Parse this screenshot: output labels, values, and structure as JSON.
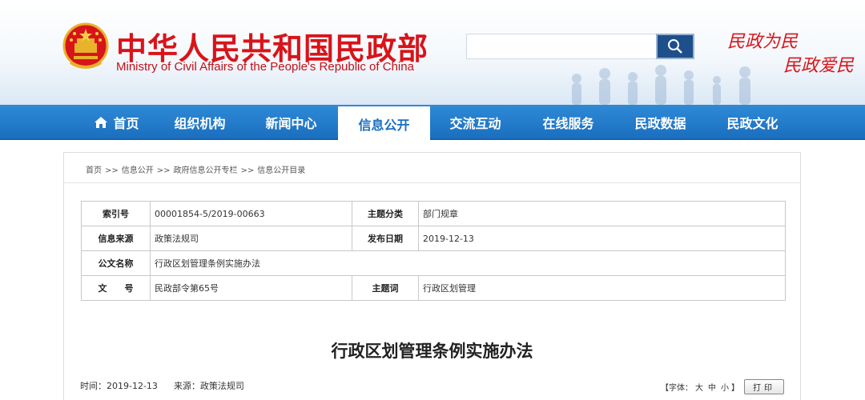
{
  "header": {
    "title_cn": "中华人民共和国民政部",
    "title_en": "Ministry of Civil Affairs of the People's Republic of China",
    "slogan_line1": "民政为民",
    "slogan_line2": "民政爱民",
    "search": {
      "placeholder": "",
      "button_icon": "search-icon"
    },
    "colors": {
      "title": "#d8141a",
      "nav": "#1a6fbf",
      "search_button": "#1d4f8a"
    }
  },
  "nav": {
    "items": [
      {
        "label": "首页",
        "icon": "home-icon"
      },
      {
        "label": "组织机构"
      },
      {
        "label": "新闻中心"
      },
      {
        "label": "信息公开",
        "active": true
      },
      {
        "label": "交流互动"
      },
      {
        "label": "在线服务"
      },
      {
        "label": "民政数据"
      },
      {
        "label": "民政文化"
      }
    ]
  },
  "breadcrumb": {
    "items": [
      "首页",
      "信息公开",
      "政府信息公开专栏",
      "信息公开目录"
    ],
    "separator": ">>"
  },
  "meta": {
    "index_label": "索引号",
    "index_value": "00001854-5/2019-00663",
    "topic_label": "主题分类",
    "topic_value": "部门规章",
    "source_label": "信息来源",
    "source_value": "政策法规司",
    "date_label": "发布日期",
    "date_value": "2019-12-13",
    "docname_label": "公文名称",
    "docname_value": "行政区划管理条例实施办法",
    "docno_label": "文　　号",
    "docno_value": "民政部令第65号",
    "keyword_label": "主题词",
    "keyword_value": "行政区划管理"
  },
  "article": {
    "title": "行政区划管理条例实施办法",
    "time_text": "时间：2019-12-13",
    "source_text": "来源：政策法规司",
    "font_size_prefix": "【字体：",
    "font_large": "大",
    "font_medium": "中",
    "font_small": "小",
    "font_size_suffix": "】",
    "print_label": "打印"
  }
}
